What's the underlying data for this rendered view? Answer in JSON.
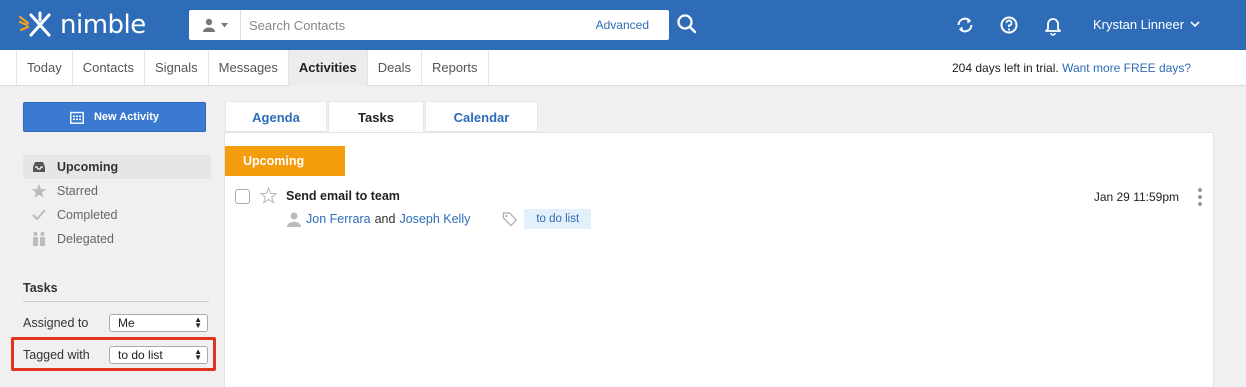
{
  "app": {
    "brand": "nimble"
  },
  "search": {
    "placeholder": "Search Contacts",
    "advanced_label": "Advanced"
  },
  "user": {
    "name": "Krystan Linneer"
  },
  "nav": {
    "tabs": [
      "Today",
      "Contacts",
      "Signals",
      "Messages",
      "Activities",
      "Deals",
      "Reports"
    ],
    "active": "Activities"
  },
  "trial": {
    "text": "204 days left in trial.",
    "link": "Want more FREE days?"
  },
  "sidebar": {
    "new_button": "New Activity",
    "items": [
      {
        "label": "Upcoming",
        "icon": "inbox-icon",
        "active": true
      },
      {
        "label": "Starred",
        "icon": "star-icon",
        "active": false
      },
      {
        "label": "Completed",
        "icon": "checkmark-icon",
        "active": false
      },
      {
        "label": "Delegated",
        "icon": "delegate-icon",
        "active": false
      }
    ],
    "tasks_title": "Tasks",
    "filters": {
      "assigned_label": "Assigned to",
      "assigned_value": "Me",
      "tagged_label": "Tagged with",
      "tagged_value": "to do list"
    }
  },
  "content": {
    "tabs": [
      "Agenda",
      "Tasks",
      "Calendar"
    ],
    "active_tab": "Tasks",
    "group_label": "Upcoming",
    "tasks": [
      {
        "title": "Send email to team",
        "person1": "Jon Ferrara",
        "conjunction": "and",
        "person2": "Joseph Kelly",
        "tag": "to do list",
        "due": "Jan 29 11:59pm"
      }
    ]
  },
  "colors": {
    "header": "#2e6cb8",
    "accent_orange": "#f39c0c",
    "highlight_red": "#e0351d"
  }
}
